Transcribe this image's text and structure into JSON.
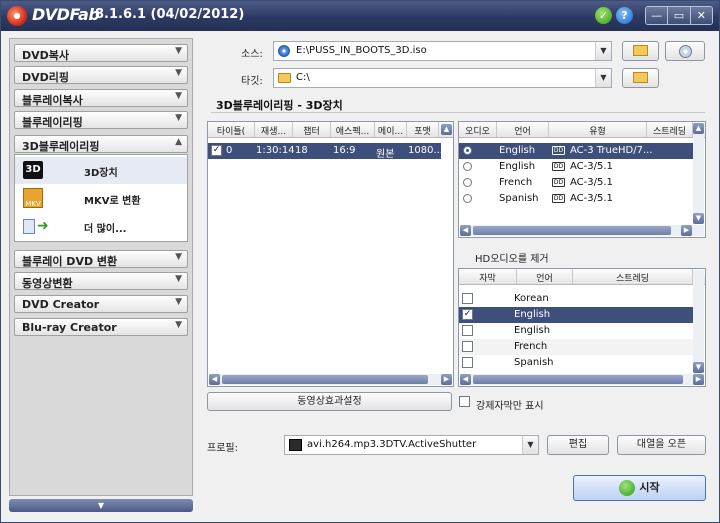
{
  "titlebar": {
    "brand": "DVDFab",
    "version": "8.1.6.1 (04/02/2012)"
  },
  "sidebar": {
    "categories": [
      {
        "label": "DVD복사"
      },
      {
        "label": "DVD리핑"
      },
      {
        "label": "블루레이복사"
      },
      {
        "label": "블루레이리핑"
      },
      {
        "label": "3D블루레이리핑"
      },
      {
        "label": "블루레이 DVD 변환"
      },
      {
        "label": "동영상변환"
      },
      {
        "label": "DVD Creator"
      },
      {
        "label": "Blu-ray Creator"
      }
    ],
    "subitems": [
      {
        "label": "3D장치",
        "icon": "3d-icon"
      },
      {
        "label": "MKV로 변환",
        "icon": "mkv-icon"
      },
      {
        "label": "더 많이...",
        "icon": "more-icon"
      }
    ],
    "icon_3d_text": "3D",
    "icon_mkv_text": "MKV"
  },
  "source": {
    "label": "소스:",
    "value": "E:\\PUSS_IN_BOOTS_3D.iso"
  },
  "target": {
    "label": "타깃:",
    "value": "C:\\"
  },
  "section_title": "3D블루레이리핑 - 3D장치",
  "titles": {
    "columns": [
      "타이틀(",
      "재생...",
      "챕터",
      "애스펙...",
      "메이...",
      "포맷"
    ],
    "rows": [
      {
        "checked": true,
        "title": "0",
        "duration": "1:30:14",
        "chapters": "18",
        "aspect": "16:9",
        "type": "원본",
        "format": "1080..."
      }
    ]
  },
  "audio": {
    "columns": [
      "오디오",
      "언어",
      "유형",
      "스트레딩"
    ],
    "rows": [
      {
        "selected": true,
        "lang": "English",
        "type": "AC-3 TrueHD/7..."
      },
      {
        "selected": false,
        "lang": "English",
        "type": "AC-3/5.1"
      },
      {
        "selected": false,
        "lang": "French",
        "type": "AC-3/5.1"
      },
      {
        "selected": false,
        "lang": "Spanish",
        "type": "AC-3/5.1"
      }
    ]
  },
  "hd_audio_label": "HD오디오를 제거",
  "subtitles": {
    "columns": [
      "자막",
      "언어",
      "스트레딩"
    ],
    "rows": [
      {
        "checked": false,
        "lang": "Korean"
      },
      {
        "checked": true,
        "lang": "English"
      },
      {
        "checked": false,
        "lang": "English"
      },
      {
        "checked": false,
        "lang": "French"
      },
      {
        "checked": false,
        "lang": "Spanish"
      }
    ]
  },
  "buttons": {
    "effects": "동영상효과설정",
    "forced_only": "강제자막만 표시",
    "edit": "편집",
    "volume_label": "대열을 오픈",
    "start": "시작"
  },
  "profile": {
    "label": "프로필:",
    "value": "avi.h264.mp3.3DTV.ActiveShutter"
  }
}
